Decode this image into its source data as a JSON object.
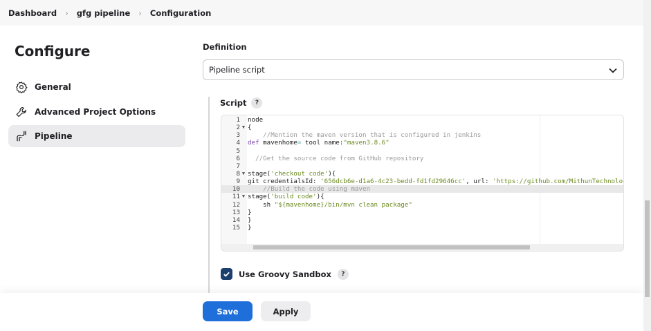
{
  "breadcrumb": [
    "Dashboard",
    "gfg pipeline",
    "Configuration"
  ],
  "page_title": "Configure",
  "nav": [
    {
      "label": "General",
      "icon": "gear-icon"
    },
    {
      "label": "Advanced Project Options",
      "icon": "wrench-icon"
    },
    {
      "label": "Pipeline",
      "icon": "pipeline-icon",
      "active": true
    }
  ],
  "definition": {
    "label": "Definition",
    "value": "Pipeline script"
  },
  "script": {
    "label": "Script",
    "help": "?",
    "current_line": 10,
    "lines": [
      [
        [
          "",
          "node"
        ]
      ],
      [
        [
          "",
          "{"
        ]
      ],
      [
        [
          "c",
          "    //Mention the maven version that is configured in jenkins"
        ]
      ],
      [
        [
          "k",
          "def"
        ],
        [
          "",
          " mavenhome"
        ],
        [
          "o",
          "="
        ],
        [
          "",
          " tool name:"
        ],
        [
          "s",
          "\"maven3.8.6\""
        ]
      ],
      [],
      [
        [
          "c",
          "  //Get the source code from GitHub repository"
        ]
      ],
      [],
      [
        [
          "",
          "stage("
        ],
        [
          "s",
          "'checkout code'"
        ],
        [
          "",
          "){"
        ]
      ],
      [
        [
          "",
          "git credentialsId: "
        ],
        [
          "s",
          "'656dcb6e-d1a6-4c23-bedd-fd1fd29646cc'"
        ],
        [
          "",
          ", url: "
        ],
        [
          "s",
          "'https://github.com/MithunTechnologiesDe"
        ]
      ],
      [
        [
          "c",
          "    //Build the code using maven"
        ]
      ],
      [
        [
          "",
          "stage("
        ],
        [
          "s",
          "'build code'"
        ],
        [
          "",
          "){"
        ]
      ],
      [
        [
          "",
          "    sh "
        ],
        [
          "s",
          "\"${mavenhome}/bin/mvn clean package\""
        ]
      ],
      [
        [
          "",
          "}"
        ]
      ],
      [
        [
          "",
          "}"
        ]
      ],
      [
        [
          "",
          "}"
        ]
      ]
    ],
    "folds": [
      2,
      8,
      11
    ]
  },
  "sandbox": {
    "label": "Use Groovy Sandbox",
    "checked": true,
    "help": "?"
  },
  "buttons": {
    "save": "Save",
    "apply": "Apply"
  },
  "colors": {
    "primary": "#1f6fdb",
    "checkbox": "#1d3f6e"
  }
}
